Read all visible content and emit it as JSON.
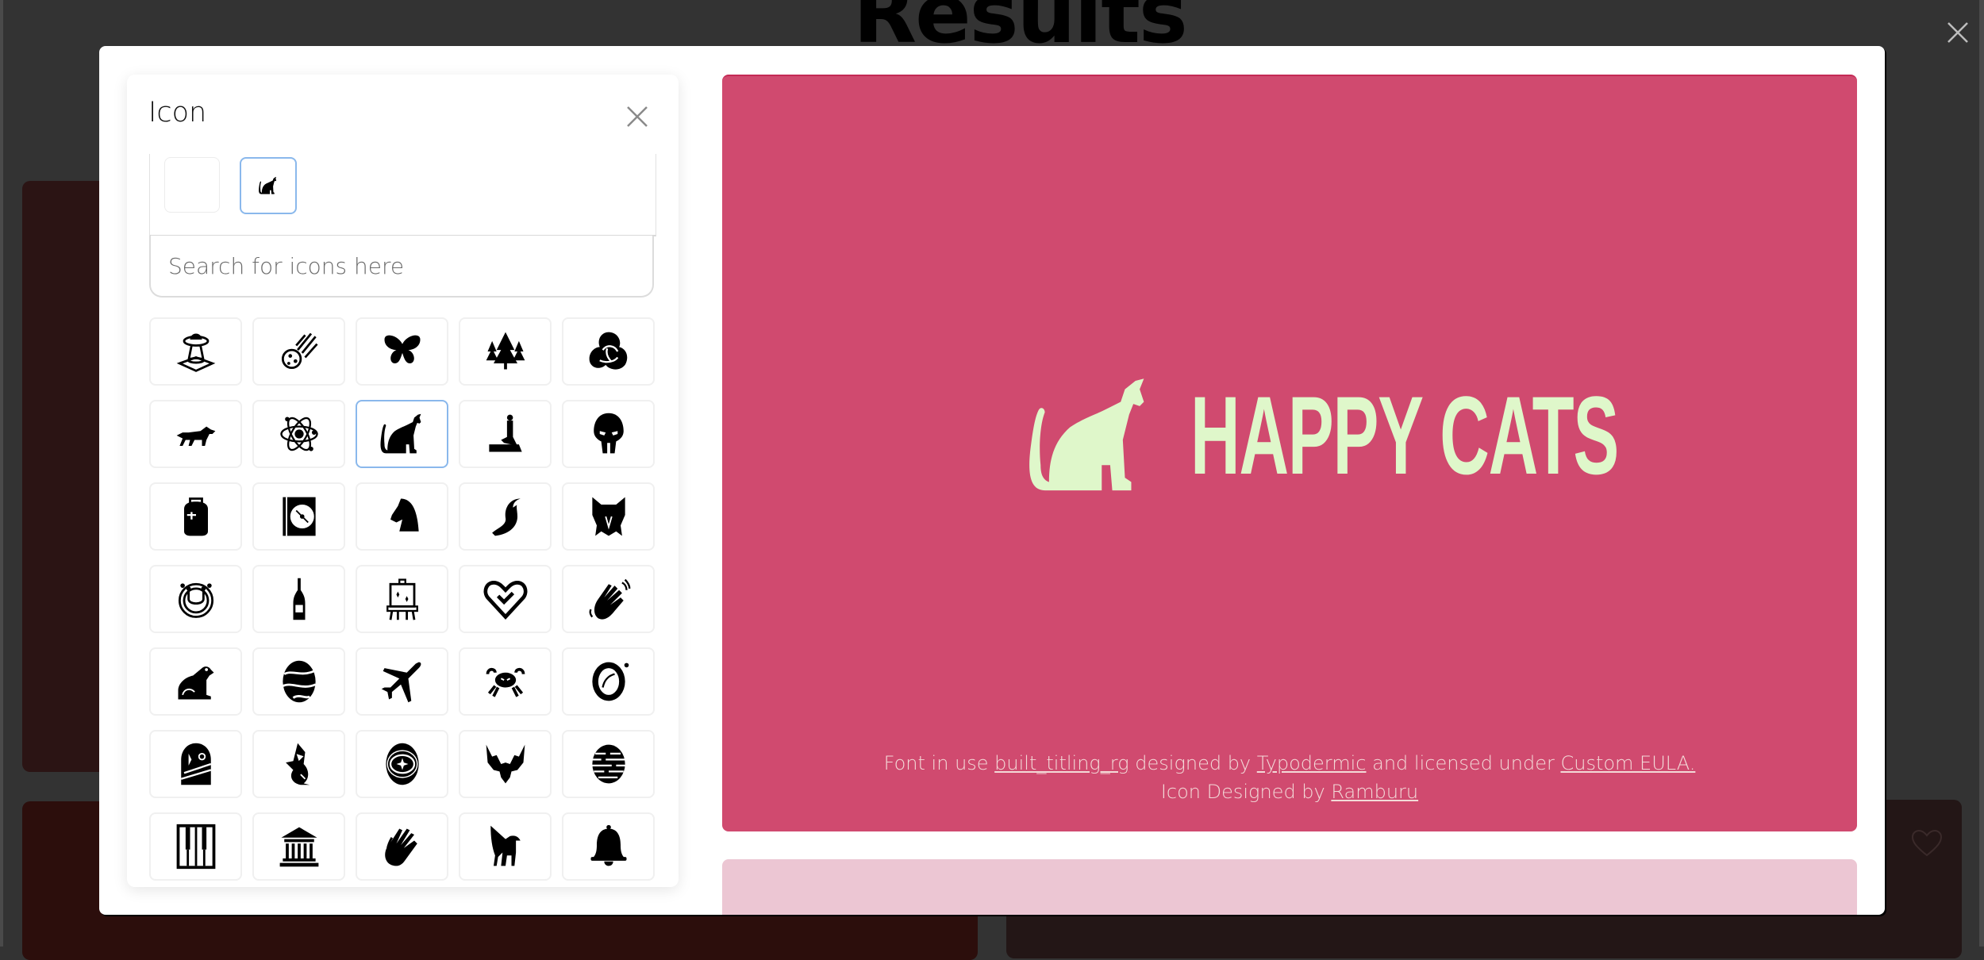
{
  "page": {
    "title": "Results",
    "colors": {
      "background": "#333333",
      "preview_background": "#d04a6f",
      "preview_foreground": "#dff7ca",
      "preview2_background": "#ecc6d3",
      "selection_border": "#8ab8ec"
    }
  },
  "icon_panel": {
    "title": "Icon",
    "close_icon": "close-icon",
    "selected_slots": [
      {
        "icon": "empty",
        "selected": false
      },
      {
        "icon": "cat-icon",
        "selected": true
      }
    ],
    "search": {
      "value": "",
      "placeholder": "Search for icons here"
    },
    "grid": [
      {
        "icon": "ufo-abduction-icon",
        "selected": false
      },
      {
        "icon": "meteor-icon",
        "selected": false
      },
      {
        "icon": "butterfly-icon",
        "selected": false
      },
      {
        "icon": "pine-trees-icon",
        "selected": false
      },
      {
        "icon": "knot-icon",
        "selected": false
      },
      {
        "icon": "wolf-icon",
        "selected": false
      },
      {
        "icon": "atom-icon",
        "selected": false
      },
      {
        "icon": "cat-icon",
        "selected": true
      },
      {
        "icon": "mermaid-statue-icon",
        "selected": false
      },
      {
        "icon": "mask-icon",
        "selected": false
      },
      {
        "icon": "backpack-icon",
        "selected": false
      },
      {
        "icon": "cd-case-icon",
        "selected": false
      },
      {
        "icon": "horse-head-icon",
        "selected": false
      },
      {
        "icon": "fox-tail-icon",
        "selected": false
      },
      {
        "icon": "wolf-head-icon",
        "selected": false
      },
      {
        "icon": "circuit-smile-icon",
        "selected": false
      },
      {
        "icon": "champagne-bottle-icon",
        "selected": false
      },
      {
        "icon": "easel-icon",
        "selected": false
      },
      {
        "icon": "heart-check-icon",
        "selected": false
      },
      {
        "icon": "clapping-hands-icon",
        "selected": false
      },
      {
        "icon": "frog-icon",
        "selected": false
      },
      {
        "icon": "planet-icon",
        "selected": false
      },
      {
        "icon": "airplane-icon",
        "selected": false
      },
      {
        "icon": "crab-icon",
        "selected": false
      },
      {
        "icon": "astronaut-helmet-icon",
        "selected": false
      },
      {
        "icon": "space-explorer-icon",
        "selected": false
      },
      {
        "icon": "shark-icon",
        "selected": false
      },
      {
        "icon": "galaxy-icon",
        "selected": false
      },
      {
        "icon": "eagle-icon",
        "selected": false
      },
      {
        "icon": "striped-planet-icon",
        "selected": false
      },
      {
        "icon": "piano-keys-icon",
        "selected": false
      },
      {
        "icon": "museum-icon",
        "selected": false
      },
      {
        "icon": "praying-hands-icon",
        "selected": false
      },
      {
        "icon": "griffin-icon",
        "selected": false
      },
      {
        "icon": "bell-icon",
        "selected": false
      }
    ]
  },
  "preview": {
    "logo_icon": "cat-icon",
    "logo_text": "HAPPY CATS",
    "credits": {
      "line1_prefix": "Font in use ",
      "font_name": "built_titling_rg",
      "line1_mid": " designed by ",
      "font_designer": "Typodermic",
      "line1_mid2": " and licensed under ",
      "license": "Custom EULA.",
      "line2_prefix": "Icon Designed by ",
      "icon_designer": "Ramburu"
    }
  }
}
